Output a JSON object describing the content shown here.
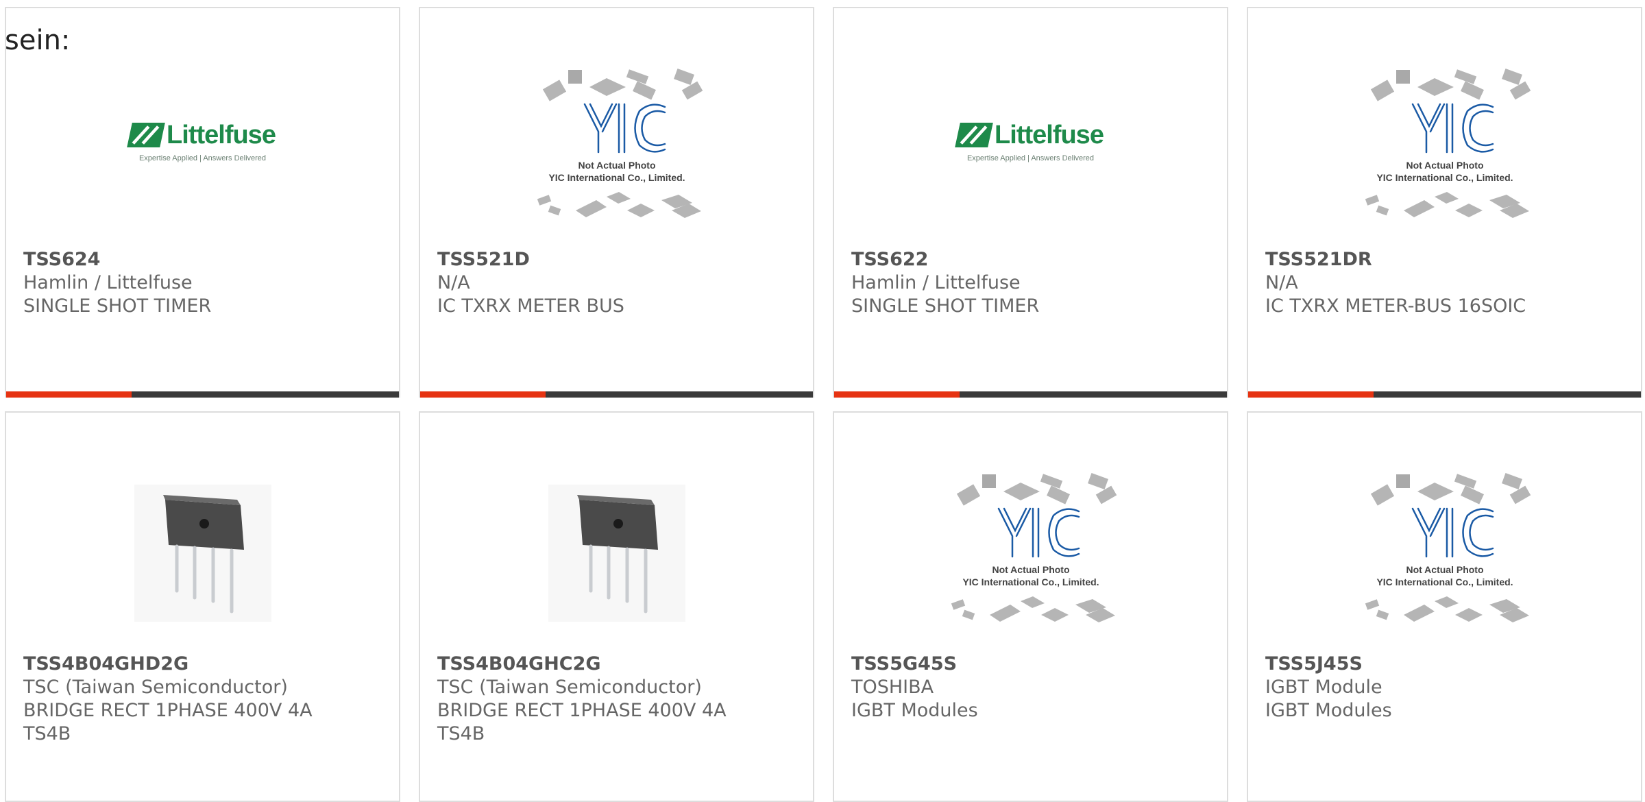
{
  "intro_text": "sein:",
  "colors": {
    "accent": "#e63312",
    "bar": "#3a3a3a",
    "border": "#dddddd",
    "littelfuse_green": "#1e8a4a",
    "yic_blue": "#1a5aa5"
  },
  "placeholders": {
    "littelfuse": {
      "name": "Littelfuse",
      "tagline": "Expertise Applied | Answers Delivered"
    },
    "yic": {
      "logo": "YIC",
      "line1": "Not Actual Photo",
      "line2": "YIC International Co., Limited."
    }
  },
  "cards": [
    {
      "part": "TSS624",
      "maker": "Hamlin / Littelfuse",
      "desc": "SINGLE SHOT TIMER",
      "extra": "",
      "image": "littelfuse-logo"
    },
    {
      "part": "TSS521D",
      "maker": "N/A",
      "desc": "IC TXRX METER BUS",
      "extra": "",
      "image": "yic-placeholder"
    },
    {
      "part": "TSS622",
      "maker": "Hamlin / Littelfuse",
      "desc": "SINGLE SHOT TIMER",
      "extra": "",
      "image": "littelfuse-logo"
    },
    {
      "part": "TSS521DR",
      "maker": "N/A",
      "desc": "IC TXRX METER-BUS 16SOIC",
      "extra": "",
      "image": "yic-placeholder"
    },
    {
      "part": "TSS4B04GHD2G",
      "maker": "TSC (Taiwan Semiconductor)",
      "desc": "BRIDGE RECT 1PHASE 400V 4A",
      "extra": "TS4B",
      "image": "bridge-rectifier"
    },
    {
      "part": "TSS4B04GHC2G",
      "maker": "TSC (Taiwan Semiconductor)",
      "desc": "BRIDGE RECT 1PHASE 400V 4A",
      "extra": "TS4B",
      "image": "bridge-rectifier"
    },
    {
      "part": "TSS5G45S",
      "maker": "TOSHIBA",
      "desc": "IGBT Modules",
      "extra": "",
      "image": "yic-placeholder"
    },
    {
      "part": "TSS5J45S",
      "maker": "IGBT Module",
      "desc": "IGBT Modules",
      "extra": "",
      "image": "yic-placeholder"
    }
  ]
}
